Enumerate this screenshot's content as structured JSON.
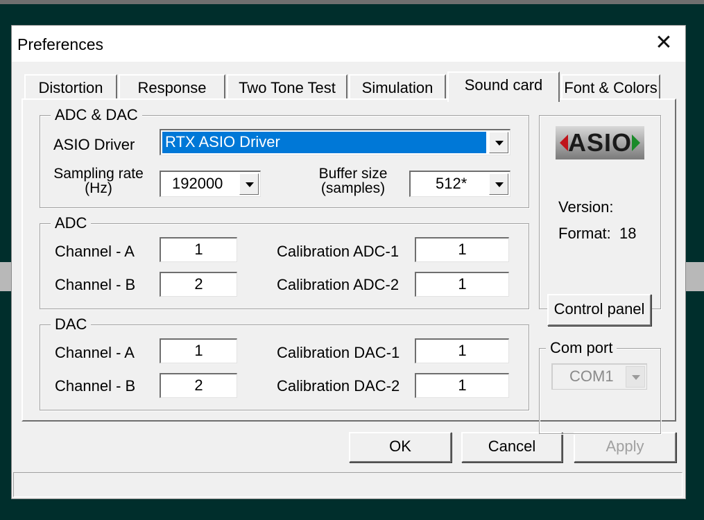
{
  "window": {
    "title": "Preferences"
  },
  "tabs": [
    {
      "label": "Distortion"
    },
    {
      "label": "Response"
    },
    {
      "label": "Two Tone Test"
    },
    {
      "label": "Simulation"
    },
    {
      "label": "Sound card",
      "active": true
    },
    {
      "label": "Font & Colors"
    }
  ],
  "adc_dac": {
    "title": "ADC & DAC",
    "asio_driver_label": "ASIO Driver",
    "asio_driver_value": "RTX ASIO Driver",
    "sampling_rate_label_1": "Sampling rate",
    "sampling_rate_label_2": "(Hz)",
    "sampling_rate_value": "192000",
    "buffer_size_label_1": "Buffer size",
    "buffer_size_label_2": "(samples)",
    "buffer_size_value": "512*"
  },
  "adc": {
    "title": "ADC",
    "channel_a_label": "Channel - A",
    "channel_a_value": "1",
    "channel_b_label": "Channel - B",
    "channel_b_value": "2",
    "cal1_label": "Calibration ADC-1",
    "cal1_value": "1",
    "cal2_label": "Calibration ADC-2",
    "cal2_value": "1"
  },
  "dac": {
    "title": "DAC",
    "channel_a_label": "Channel - A",
    "channel_a_value": "1",
    "channel_b_label": "Channel - B",
    "channel_b_value": "2",
    "cal1_label": "Calibration DAC-1",
    "cal1_value": "1",
    "cal2_label": "Calibration DAC-2",
    "cal2_value": "1"
  },
  "asio_info": {
    "logo_text": "ASIO",
    "version_label": "Version:",
    "version_value": "",
    "format_label": "Format:",
    "format_value": "18",
    "control_panel_label": "Control panel"
  },
  "com_port": {
    "title": "Com port",
    "value": "COM1"
  },
  "buttons": {
    "ok": "OK",
    "cancel": "Cancel",
    "apply": "Apply"
  },
  "colors": {
    "desktop": "#002e2c",
    "selection": "#0078d7",
    "dialog_face": "#f0f0f0"
  }
}
